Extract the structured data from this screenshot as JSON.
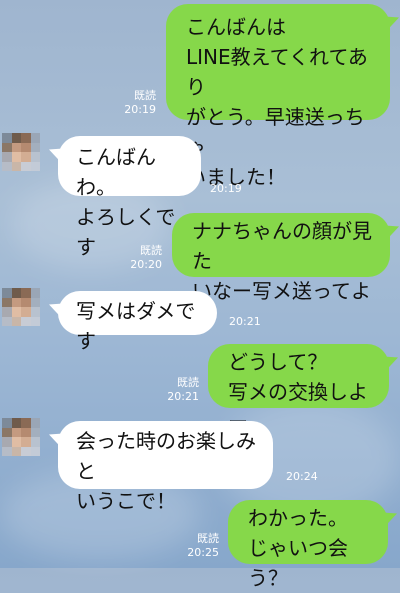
{
  "messages": [
    {
      "side": "sent",
      "text": "こんばんは\nLINE教えてくれてあり\nがとう。早速送っちゃ\nいました！",
      "read": "既読",
      "time": "20:19"
    },
    {
      "side": "recv",
      "text": "こんばんわ。\nよろしくです",
      "time": "20:19"
    },
    {
      "side": "sent",
      "text": "ナナちゃんの顔が見た\nいなー写メ送ってよ",
      "read": "既読",
      "time": "20:20"
    },
    {
      "side": "recv",
      "text": "写メはダメです",
      "time": "20:21"
    },
    {
      "side": "sent",
      "text": "どうして？\n写メの交換しよー",
      "read": "既読",
      "time": "20:21"
    },
    {
      "side": "recv",
      "text": "会った時のお楽しみと\nいうこで！",
      "time": "20:24"
    },
    {
      "side": "sent",
      "text": "わかった。\nじゃいつ会う？",
      "read": "既読",
      "time": "20:25"
    }
  ],
  "colors": {
    "sent_bubble": "#86d84a",
    "recv_bubble": "#ffffff",
    "background": "#a6bcd4"
  },
  "avatar_icon": "pixelated-avatar-icon"
}
